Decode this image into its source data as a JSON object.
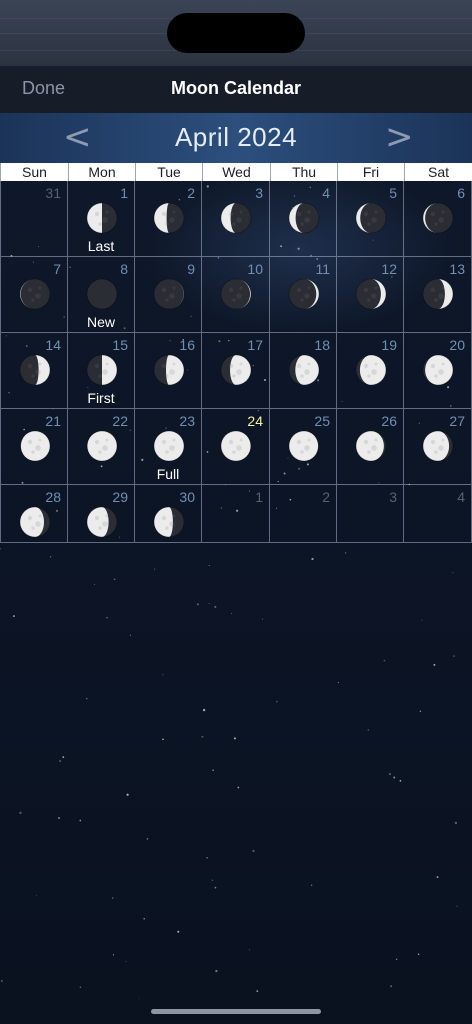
{
  "nav": {
    "done_label": "Done",
    "title": "Moon Calendar"
  },
  "month": {
    "title": "April 2024",
    "prev_icon": "chevron-left-icon",
    "next_icon": "chevron-right-icon",
    "prev_glyph": "<",
    "next_glyph": ">"
  },
  "weekdays": [
    "Sun",
    "Mon",
    "Tue",
    "Wed",
    "Thu",
    "Fri",
    "Sat"
  ],
  "colors": {
    "day_number": "#6f8fb3",
    "other_month_number": "#56606e",
    "today_number": "#f2f2a0",
    "moon_lit": "#ececec",
    "moon_dark": "#2a2d33"
  },
  "today": 24,
  "weeks": [
    [
      {
        "day": "31",
        "other_month": true
      },
      {
        "day": "1",
        "illumination": 0.5,
        "waxing": false,
        "label": "Last"
      },
      {
        "day": "2",
        "illumination": 0.42,
        "waxing": false
      },
      {
        "day": "3",
        "illumination": 0.32,
        "waxing": false
      },
      {
        "day": "4",
        "illumination": 0.22,
        "waxing": false
      },
      {
        "day": "5",
        "illumination": 0.14,
        "waxing": false
      },
      {
        "day": "6",
        "illumination": 0.07,
        "waxing": false
      }
    ],
    [
      {
        "day": "7",
        "illumination": 0.02,
        "waxing": false
      },
      {
        "day": "8",
        "illumination": 0.0,
        "waxing": true,
        "label": "New"
      },
      {
        "day": "9",
        "illumination": 0.01,
        "waxing": true
      },
      {
        "day": "10",
        "illumination": 0.03,
        "waxing": true
      },
      {
        "day": "11",
        "illumination": 0.09,
        "waxing": true
      },
      {
        "day": "12",
        "illumination": 0.17,
        "waxing": true
      },
      {
        "day": "13",
        "illumination": 0.27,
        "waxing": true
      }
    ],
    [
      {
        "day": "14",
        "illumination": 0.38,
        "waxing": true
      },
      {
        "day": "15",
        "illumination": 0.5,
        "waxing": true,
        "label": "First"
      },
      {
        "day": "16",
        "illumination": 0.6,
        "waxing": true
      },
      {
        "day": "17",
        "illumination": 0.7,
        "waxing": true
      },
      {
        "day": "18",
        "illumination": 0.79,
        "waxing": true
      },
      {
        "day": "19",
        "illumination": 0.87,
        "waxing": true
      },
      {
        "day": "20",
        "illumination": 0.93,
        "waxing": true
      }
    ],
    [
      {
        "day": "21",
        "illumination": 0.97,
        "waxing": true
      },
      {
        "day": "22",
        "illumination": 0.99,
        "waxing": true
      },
      {
        "day": "23",
        "illumination": 1.0,
        "waxing": true,
        "label": "Full"
      },
      {
        "day": "24",
        "illumination": 0.99,
        "waxing": false,
        "today": true
      },
      {
        "day": "25",
        "illumination": 0.97,
        "waxing": false
      },
      {
        "day": "26",
        "illumination": 0.93,
        "waxing": false
      },
      {
        "day": "27",
        "illumination": 0.87,
        "waxing": false
      }
    ],
    [
      {
        "day": "28",
        "illumination": 0.8,
        "waxing": false
      },
      {
        "day": "29",
        "illumination": 0.72,
        "waxing": false
      },
      {
        "day": "30",
        "illumination": 0.63,
        "waxing": false
      },
      {
        "day": "1",
        "other_month": true
      },
      {
        "day": "2",
        "other_month": true
      },
      {
        "day": "3",
        "other_month": true
      },
      {
        "day": "4",
        "other_month": true
      }
    ]
  ]
}
